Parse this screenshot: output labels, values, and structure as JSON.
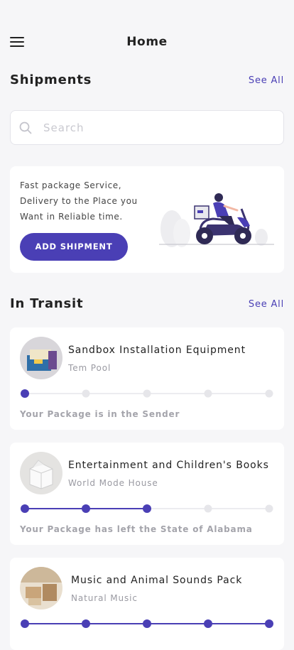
{
  "header": {
    "title": "Home"
  },
  "shipments": {
    "title": "Shipments",
    "see_all": "See All"
  },
  "search": {
    "placeholder": "Search"
  },
  "promo": {
    "lines": [
      "Fast package Service,",
      "Delivery to the Place you",
      "Want in Reliable time."
    ],
    "button": "ADD SHIPMENT"
  },
  "in_transit": {
    "title": "In Transit",
    "see_all": "See All",
    "items": [
      {
        "title": "Sandbox  Installation Equipment",
        "subtitle": "Tem Pool",
        "status": "Your Package is in the Sender",
        "progress_step": 1,
        "total_steps": 5
      },
      {
        "title": "Entertainment and Children's Books",
        "subtitle": "World Mode House",
        "status": "Your Package has left the State of Alabama",
        "progress_step": 3,
        "total_steps": 5
      },
      {
        "title": "Music and Animal Sounds Pack",
        "subtitle": "Natural Music",
        "status": "",
        "progress_step": 5,
        "total_steps": 5
      }
    ]
  },
  "colors": {
    "accent": "#4a3fb5",
    "inactive_dot": "#e6e6ea",
    "background": "#f6f6f8"
  }
}
